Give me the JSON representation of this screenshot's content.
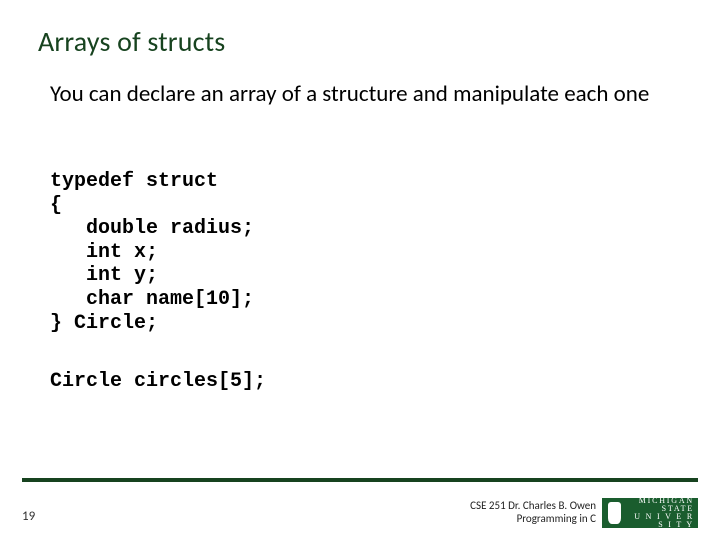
{
  "title": "Arrays of structs",
  "body": "You can declare an array of a structure and manipulate each one",
  "code_block_1": "typedef struct\n{\n   double radius;\n   int x;\n   int y;\n   char name[10];\n} Circle;",
  "code_block_2": "Circle circles[5];",
  "page_number": "19",
  "footer": {
    "line1": "CSE 251 Dr. Charles B. Owen",
    "line2": "Programming in C",
    "logo_top": "MICHIGAN STATE",
    "logo_bottom": "U N I V E R S I T Y"
  }
}
